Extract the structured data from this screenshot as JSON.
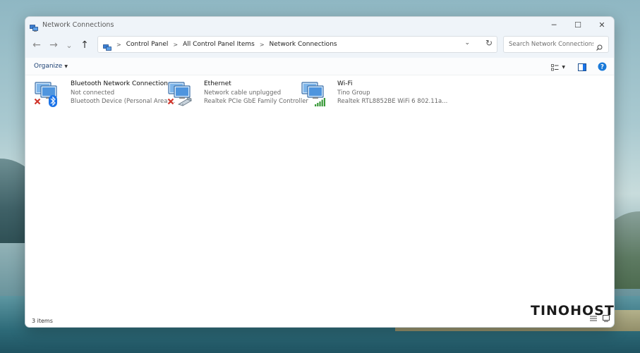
{
  "window": {
    "title": "Network Connections",
    "controls": {
      "minimize": "─",
      "maximize": "☐",
      "close": "✕"
    }
  },
  "navigation": {
    "back_glyph": "←",
    "forward_glyph": "→",
    "recent_glyph": "⌄",
    "up_glyph": "↑",
    "breadcrumb": [
      "Control Panel",
      "All Control Panel Items",
      "Network Connections"
    ],
    "refresh_glyph": "↻",
    "dropdown_glyph": "⌄"
  },
  "search": {
    "placeholder": "Search Network Connections"
  },
  "toolbar": {
    "organize_label": "Organize"
  },
  "connections": [
    {
      "name": "Bluetooth Network Connection",
      "status": "Not connected",
      "device": "Bluetooth Device (Personal Area ...",
      "badge": "bluetooth-icon",
      "error": true
    },
    {
      "name": "Ethernet",
      "status": "Network cable unplugged",
      "device": "Realtek PCIe GbE Family Controller",
      "badge": "ethernet-cable-icon",
      "error": true
    },
    {
      "name": "Wi-Fi",
      "status": "Tino Group",
      "device": "Realtek RTL8852BE WiFi 6 802.11a...",
      "badge": "wifi-signal-icon",
      "error": false
    }
  ],
  "statusbar": {
    "item_count": "3 items"
  },
  "watermark": {
    "brand": "TINOHOST"
  },
  "colors": {
    "accent": "#1a73e8",
    "error_red": "#d0352b",
    "signal_green": "#3a9a3a",
    "help_blue": "#1a7ad9"
  }
}
